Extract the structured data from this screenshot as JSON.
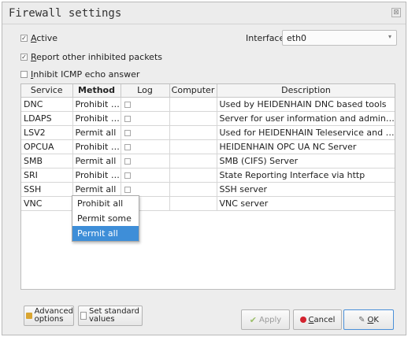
{
  "window": {
    "title": "Firewall settings",
    "close_glyph": "⊠"
  },
  "options": {
    "active_label_u": "A",
    "active_label_rest": "ctive",
    "active_checked": true,
    "report_label_u": "R",
    "report_label_rest": "eport other inhibited packets",
    "report_checked": true,
    "icmp_label_u": "I",
    "icmp_label_rest": "nhibit ICMP echo answer",
    "icmp_checked": false
  },
  "interface": {
    "label": "Interface",
    "value": "eth0"
  },
  "table": {
    "headers": [
      "Service",
      "Method",
      "Log",
      "Computer",
      "Description"
    ],
    "rows": [
      {
        "service": "DNC",
        "method": "Prohibit all",
        "description": "Used by HEIDENHAIN DNC based tools"
      },
      {
        "service": "LDAPS",
        "method": "Prohibit all",
        "description": "Server for user information and administ..."
      },
      {
        "service": "LSV2",
        "method": "Permit all",
        "description": "Used for HEIDENHAIN Teleservice and T..."
      },
      {
        "service": "OPCUA",
        "method": "Prohibit all",
        "description": "HEIDENHAIN OPC UA NC Server"
      },
      {
        "service": "SMB",
        "method": "Permit all",
        "description": "SMB (CIFS) Server"
      },
      {
        "service": "SRI",
        "method": "Prohibit all",
        "description": "State Reporting Interface via http"
      },
      {
        "service": "SSH",
        "method": "Permit all",
        "description": "SSH server"
      },
      {
        "service": "VNC",
        "method": "",
        "description": "VNC server"
      }
    ]
  },
  "dropdown": {
    "options": [
      "Prohibit all",
      "Permit some",
      "Permit all"
    ],
    "selected_index": 2
  },
  "buttons": {
    "advanced_line1": "Advanced",
    "advanced_line2": "options",
    "standard_line1": "Set standard",
    "standard_line2": "values",
    "apply": "Apply",
    "cancel_u": "C",
    "cancel_rest": "ancel",
    "ok_u": "O",
    "ok_rest": "K"
  },
  "colors": {
    "selection": "#3e8ed8",
    "cancel_dot": "#d3232f",
    "ok_border": "#4a90d9"
  }
}
